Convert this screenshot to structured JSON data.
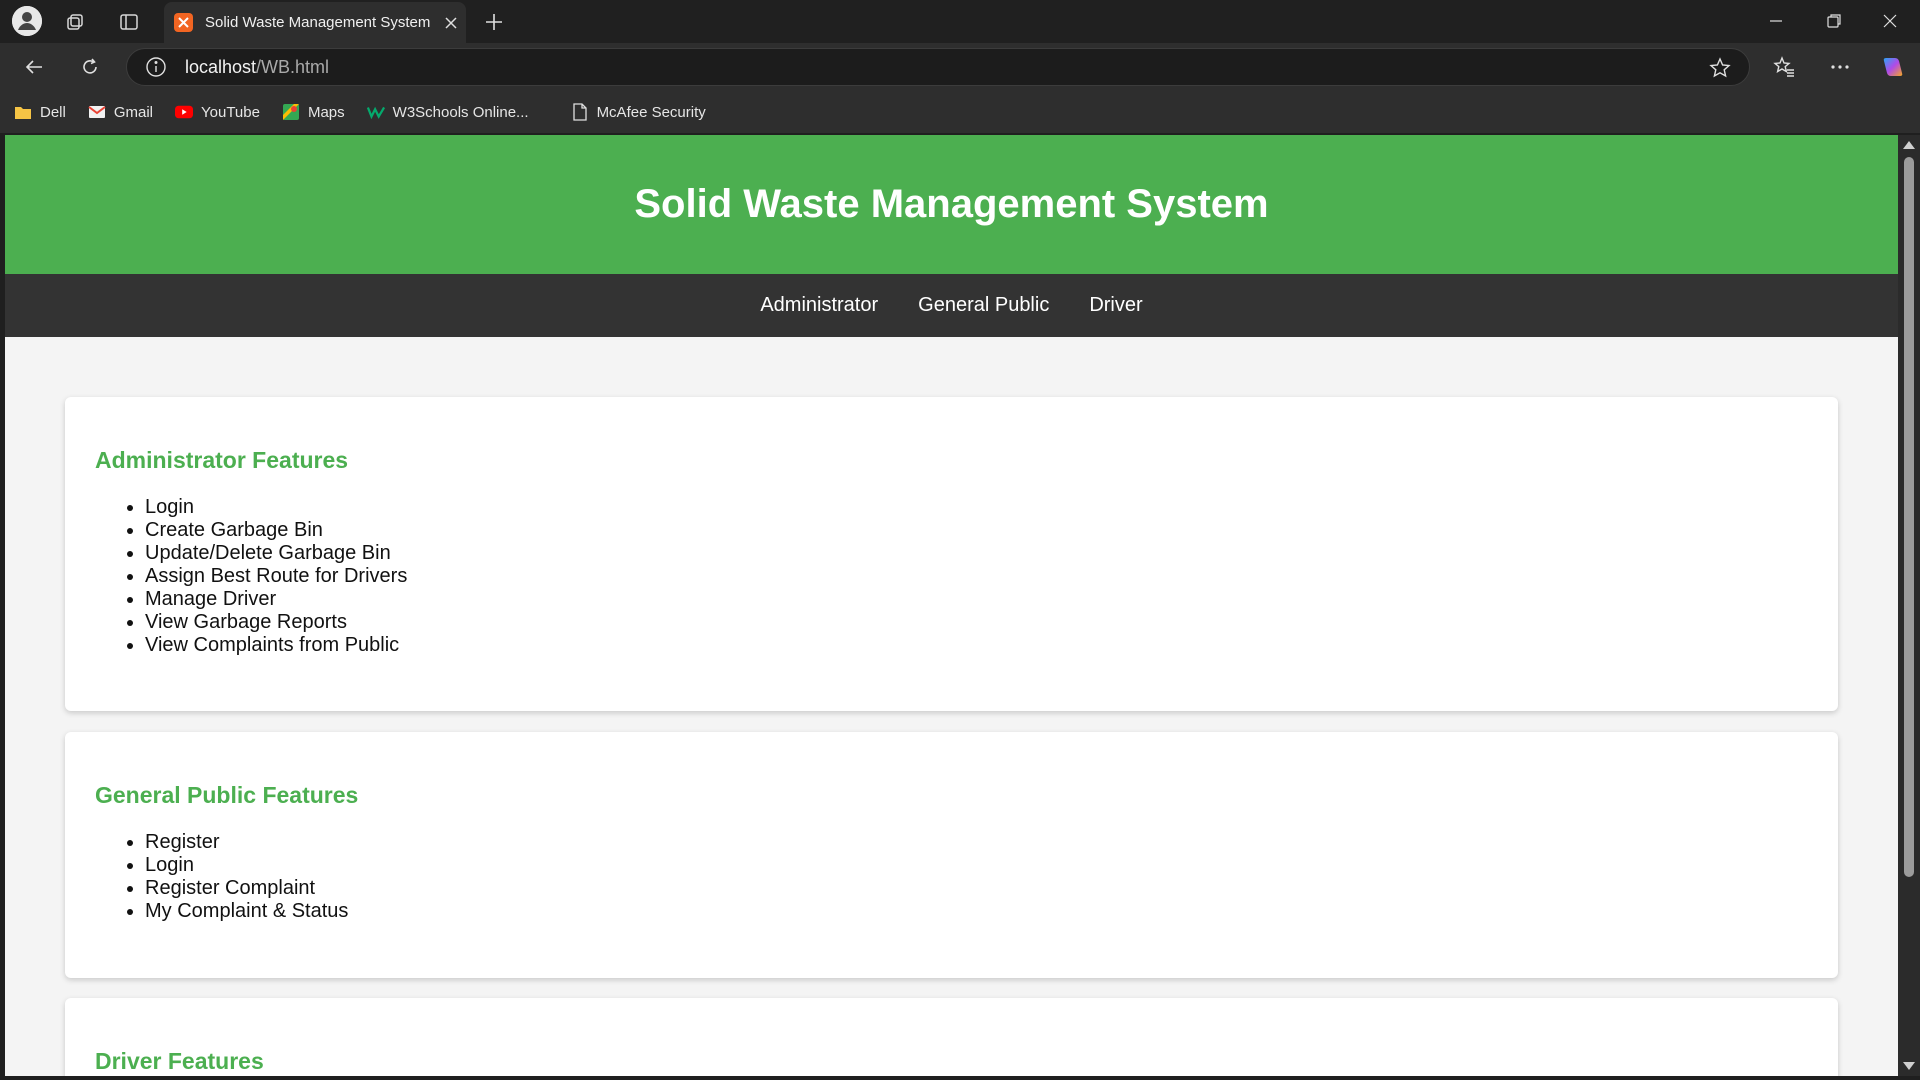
{
  "browser": {
    "tab_title": "Solid Waste Management System",
    "url_host": "localhost",
    "url_path": "/WB.html",
    "bookmarks": [
      {
        "label": "Dell",
        "icon": "folder-icon"
      },
      {
        "label": "Gmail",
        "icon": "gmail-icon"
      },
      {
        "label": "YouTube",
        "icon": "youtube-icon"
      },
      {
        "label": "Maps",
        "icon": "maps-icon"
      },
      {
        "label": "W3Schools Online...",
        "icon": "w3schools-icon"
      },
      {
        "label": "McAfee Security",
        "icon": "page-icon"
      }
    ]
  },
  "page": {
    "title": "Solid Waste Management System",
    "nav": [
      "Administrator",
      "General Public",
      "Driver"
    ],
    "sections": [
      {
        "heading": "Administrator Features",
        "items": [
          "Login",
          "Create Garbage Bin",
          "Update/Delete Garbage Bin",
          "Assign Best Route for Drivers",
          "Manage Driver",
          "View Garbage Reports",
          "View Complaints from Public"
        ]
      },
      {
        "heading": "General Public Features",
        "items": [
          "Register",
          "Login",
          "Register Complaint",
          "My Complaint & Status"
        ]
      },
      {
        "heading": "Driver Features",
        "items": []
      }
    ]
  },
  "colors": {
    "header_green": "#4caf50",
    "nav_dark": "#333333",
    "page_bg": "#f4f4f4"
  }
}
